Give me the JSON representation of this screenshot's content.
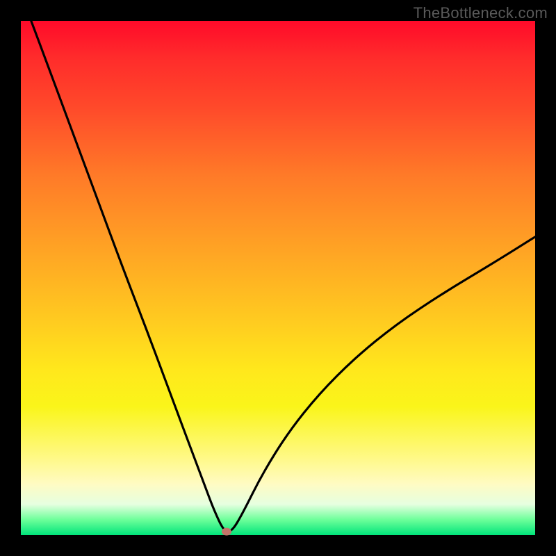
{
  "watermark": "TheBottleneck.com",
  "chart_data": {
    "type": "line",
    "title": "",
    "xlabel": "",
    "ylabel": "",
    "xlim": [
      0,
      100
    ],
    "ylim": [
      0,
      100
    ],
    "series": [
      {
        "name": "curve",
        "x": [
          2,
          5,
          10,
          15,
          20,
          25,
          30,
          33,
          36,
          37.5,
          39.5,
          41,
          43,
          47,
          52,
          58,
          65,
          73,
          82,
          92,
          100
        ],
        "y": [
          100,
          92,
          78.5,
          65,
          51.5,
          38.5,
          25,
          17,
          9,
          5,
          0.7,
          0.7,
          4,
          12,
          20,
          27.5,
          34.5,
          41,
          47,
          53,
          58
        ]
      }
    ],
    "marker": {
      "x": 40,
      "y": 0.7,
      "color": "#c4746a"
    },
    "gradient_stops": [
      {
        "pct": 0,
        "color": "#ff0a2a"
      },
      {
        "pct": 45,
        "color": "#ffa524"
      },
      {
        "pct": 75,
        "color": "#faf51a"
      },
      {
        "pct": 100,
        "color": "#00e47a"
      }
    ]
  }
}
